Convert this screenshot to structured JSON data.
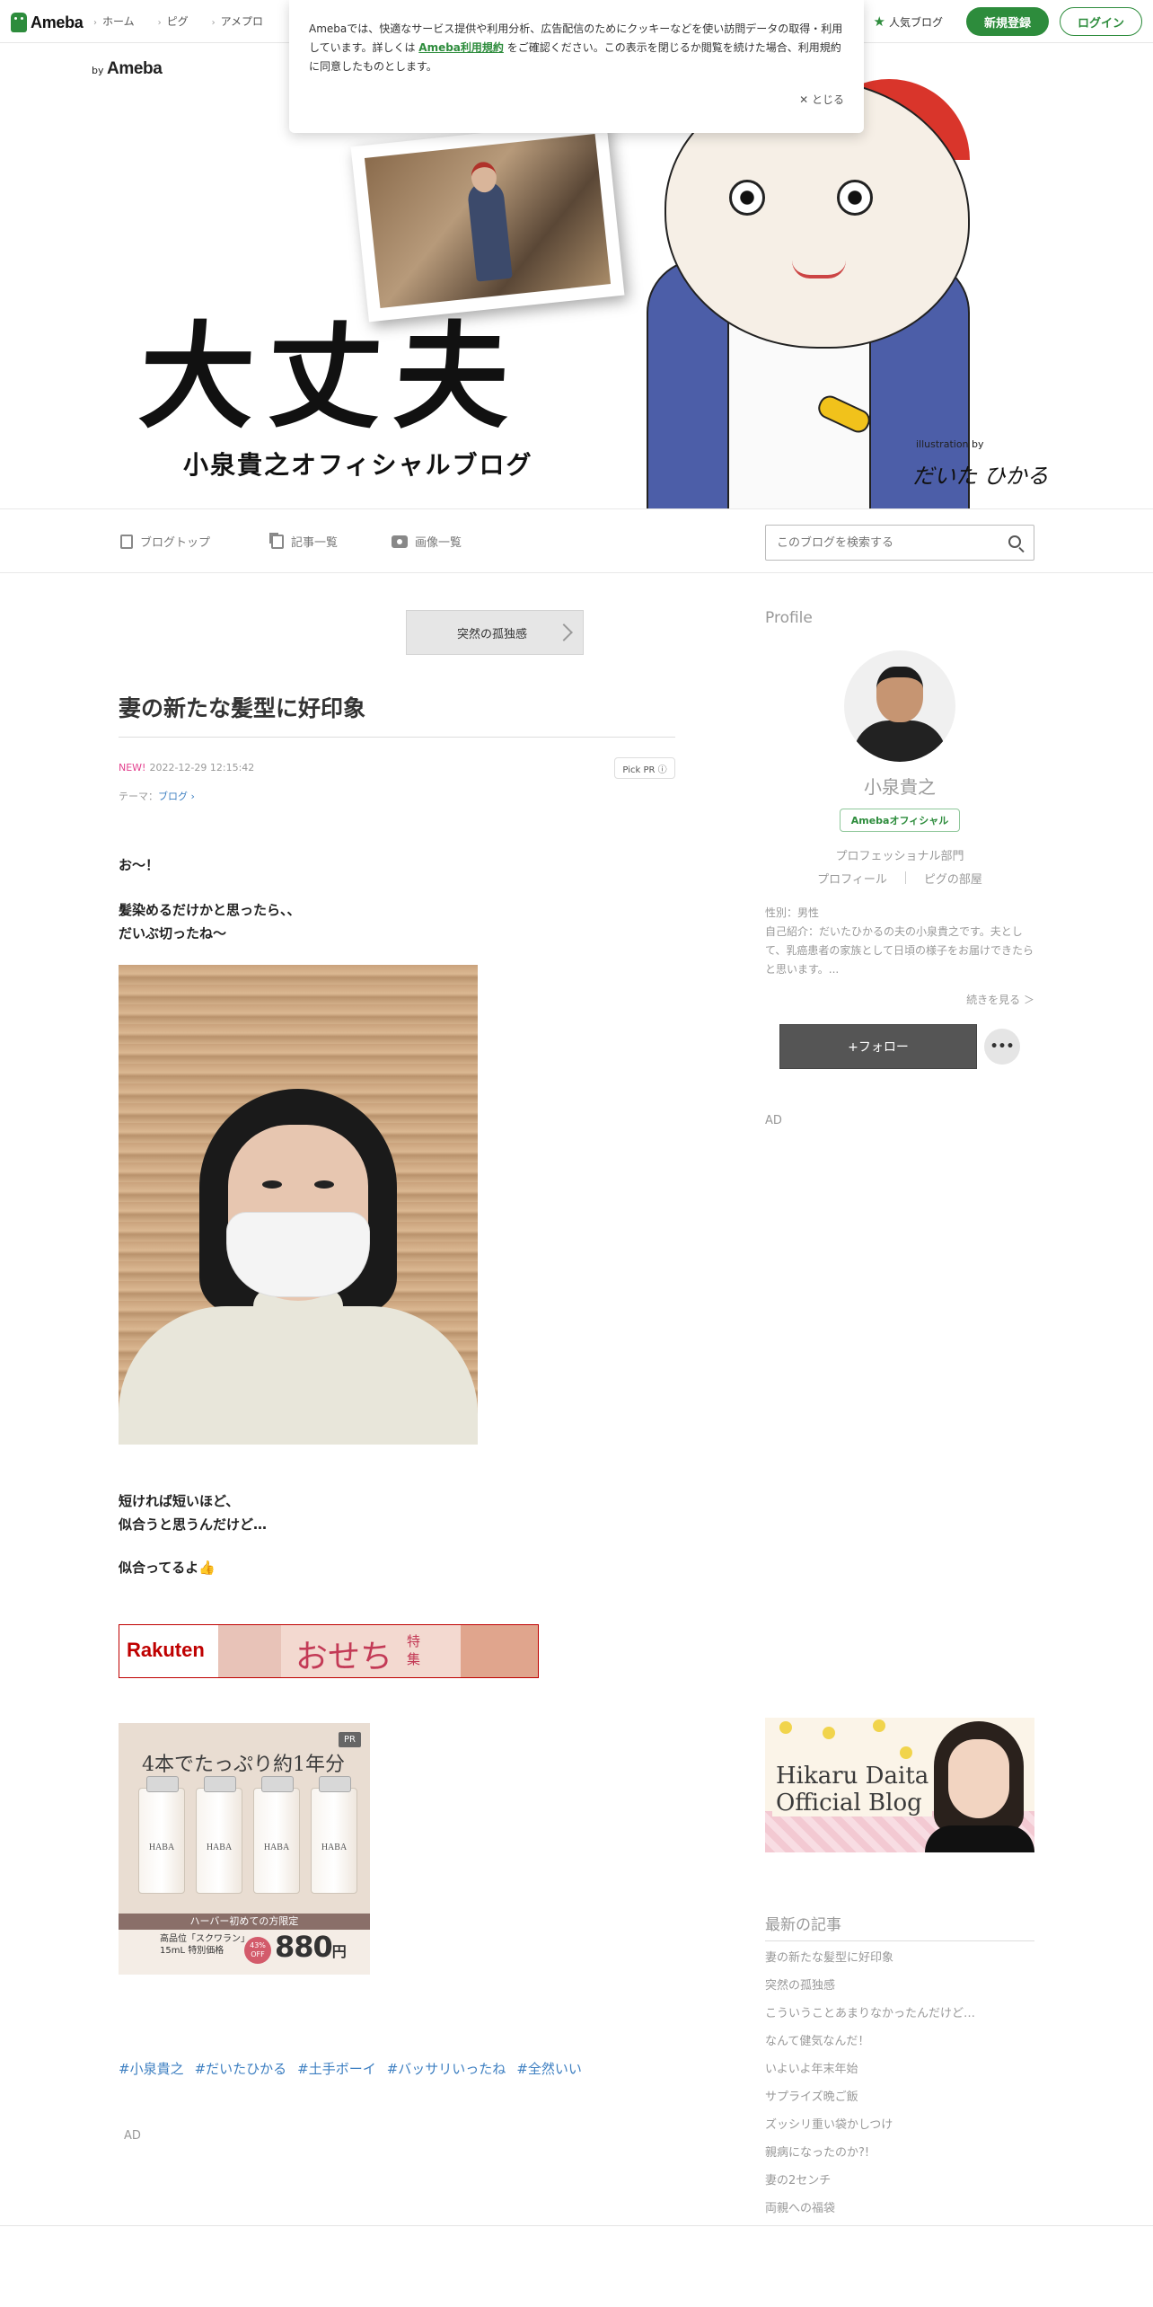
{
  "topnav": {
    "logo": "Ameba",
    "links": [
      "ホーム",
      "ピグ",
      "アメプロ"
    ],
    "popular": "人気ブログ",
    "signup": "新規登録",
    "login": "ログイン"
  },
  "cookie": {
    "text_before": "Amebaでは、快適なサービス提供や利用分析、広告配信のためにクッキーなどを使い訪問データの取得・利用しています。詳しくは",
    "link": "Ameba利用規約",
    "text_after": "をご確認ください。この表示を閉じるか閲覧を続けた場合、利用規約に同意したものとします。",
    "close": "とじる"
  },
  "header": {
    "by": "by",
    "by_brand": "Ameba",
    "title": "大丈夫",
    "subtitle": "小泉貴之オフィシャルブログ",
    "illus_by": "illustration by",
    "illus_sign": "だいた ひかる"
  },
  "blognav": {
    "top": "ブログトップ",
    "entries": "記事一覧",
    "images": "画像一覧",
    "search_placeholder": "このブログを検索する"
  },
  "article": {
    "prev_post": "突然の孤独感",
    "title": "妻の新たな髪型に好印象",
    "new_label": "NEW!",
    "date": "2022-12-29 12:15:42",
    "pick_pr": "Pick PR ⓘ",
    "theme_label": "テーマ：",
    "theme": "ブログ",
    "p1": "お〜！",
    "p2a": "髪染めるだけかと思ったら、、",
    "p2b": "だいぶ切ったね〜",
    "p3a": "短ければ短いほど、",
    "p3b": "似合うと思うんだけど…",
    "p4": "似合ってるよ👍",
    "hashtags": [
      "#小泉貴之",
      "#だいたひかる",
      "#土手ボーイ",
      "#バッサリいったね",
      "#全然いい"
    ],
    "ad": "AD"
  },
  "ads": {
    "rakuten_logo": "Rakuten",
    "rakuten_osechi": "おせち",
    "rakuten_toku": "特集",
    "haba_pr": "PR",
    "haba_head": "4本でたっぷり約1年分",
    "haba_bottle": "HABA",
    "haba_band": "ハーバー初めての方限定",
    "haba_product": "高品位「スクワラン」",
    "haba_size": "15mL 特別価格",
    "haba_off": "43% OFF",
    "haba_price": "880",
    "haba_yen": "円"
  },
  "sidebar": {
    "profile_heading": "Profile",
    "name": "小泉貴之",
    "official": "Amebaオフィシャル",
    "category": "プロフェッショナル部門",
    "link_profile": "プロフィール",
    "link_pig": "ピグの部屋",
    "gender": "性別：男性",
    "intro": "自己紹介：だいたひかるの夫の小泉貴之です。夫として、乳癌患者の家族として日頃の様子をお届けできたらと思います。...",
    "more": "続きを見る ＞",
    "follow": "+フォロー",
    "dots": "•••",
    "ad": "AD",
    "hikaru_title_1": "Hikaru Daita",
    "hikaru_title_2": "Official Blog",
    "recent_heading": "最新の記事",
    "recent": [
      "妻の新たな髪型に好印象",
      "突然の孤独感",
      "こういうことあまりなかったんだけど…",
      "なんて健気なんだ！",
      "いよいよ年末年始",
      "サプライズ晩ご飯",
      "ズッシリ重い袋かしつけ",
      "親病になったのか?!",
      "妻の2センチ",
      "両親への福袋"
    ]
  }
}
